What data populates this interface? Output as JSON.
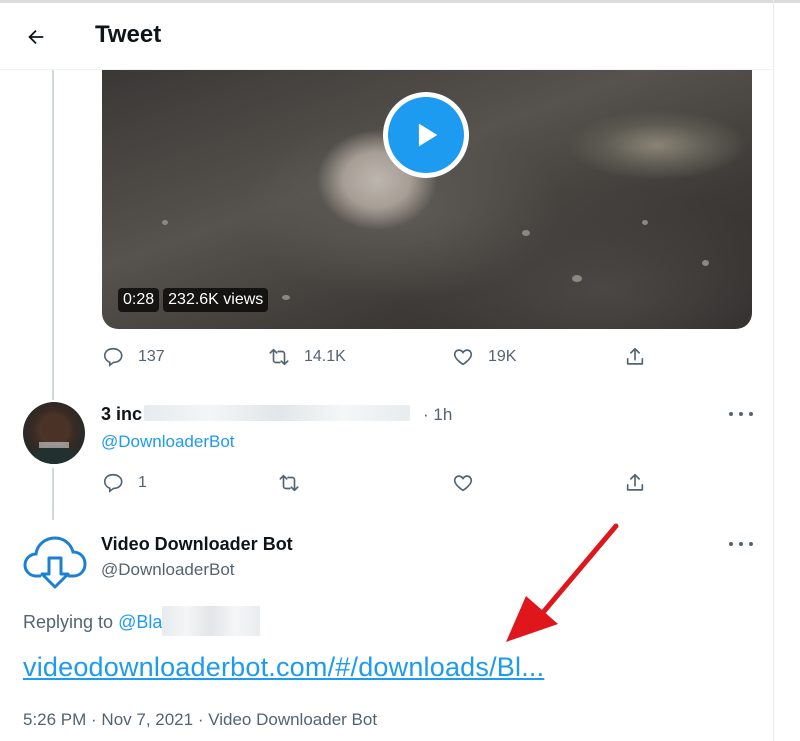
{
  "header": {
    "title": "Tweet"
  },
  "video": {
    "duration": "0:28",
    "views": "232.6K views"
  },
  "tweet_actions": {
    "replies": "137",
    "retweets": "14.1K",
    "likes": "19K"
  },
  "reply1": {
    "name_prefix": "3 inc",
    "time": "· 1h",
    "handle": "@DownloaderBot",
    "replies": "1"
  },
  "reply2": {
    "name": "Video Downloader Bot",
    "handle": "@DownloaderBot",
    "replying_label": "Replying to",
    "replying_mention": "@Bla",
    "link": "videodownloaderbot.com/#/downloads/Bl...",
    "meta": "5:26 PM · Nov 7, 2021 · Video Downloader Bot"
  },
  "colors": {
    "accent": "#1d9bf0",
    "muted": "#536471",
    "annotation_arrow": "#e0161d"
  }
}
